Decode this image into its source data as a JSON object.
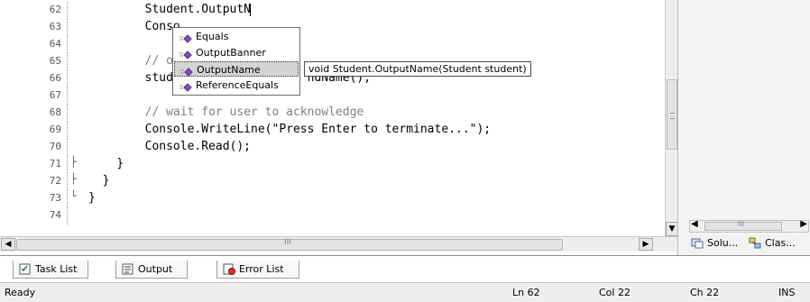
{
  "editor": {
    "lines": [
      {
        "num": "62",
        "code": "        Student.OutputN",
        "type": "code",
        "caret": true
      },
      {
        "num": "63",
        "code": "        Conso",
        "type": "code"
      },
      {
        "num": "64",
        "code": "",
        "type": "code"
      },
      {
        "num": "65",
        "code": "        // ou",
        "type": "comment"
      },
      {
        "num": "66",
        "code": "        stude                  ndName();",
        "type": "code"
      },
      {
        "num": "67",
        "code": "",
        "type": "code"
      },
      {
        "num": "68",
        "code": "        // wait for user to acknowledge",
        "type": "comment"
      },
      {
        "num": "69",
        "code": "        Console.WriteLine(\"Press Enter to terminate...\");",
        "type": "code"
      },
      {
        "num": "70",
        "code": "        Console.Read();",
        "type": "code"
      },
      {
        "num": "71",
        "code": "    }",
        "type": "code",
        "fold": "├"
      },
      {
        "num": "72",
        "code": "  }",
        "type": "code",
        "fold": "├"
      },
      {
        "num": "73",
        "code": "}",
        "type": "code",
        "fold": "└"
      },
      {
        "num": "74",
        "code": "",
        "type": "code"
      }
    ]
  },
  "intellisense": {
    "items": [
      {
        "label": "Equals",
        "selected": false
      },
      {
        "label": "OutputBanner",
        "selected": false
      },
      {
        "label": "OutputName",
        "selected": true
      },
      {
        "label": "ReferenceEquals",
        "selected": false
      }
    ],
    "tooltip": "void Student.OutputName(Student student)"
  },
  "right_pane": {
    "tabs": [
      {
        "label": "Solu...",
        "icon": "solution-explorer-icon"
      },
      {
        "label": "Clas...",
        "icon": "class-view-icon"
      }
    ],
    "scroll_grip": "III"
  },
  "bottom_tabs": [
    {
      "label": "Task List",
      "icon": "task-list-icon"
    },
    {
      "label": "Output",
      "icon": "output-icon"
    },
    {
      "label": "Error List",
      "icon": "error-list-icon"
    }
  ],
  "hscroll_grip": "III",
  "status": {
    "ready": "Ready",
    "line": "Ln 62",
    "col": "Col 22",
    "ch": "Ch 22",
    "mode": "INS"
  },
  "colors": {
    "comment": "#808080",
    "selection": "#d4d4d4"
  }
}
